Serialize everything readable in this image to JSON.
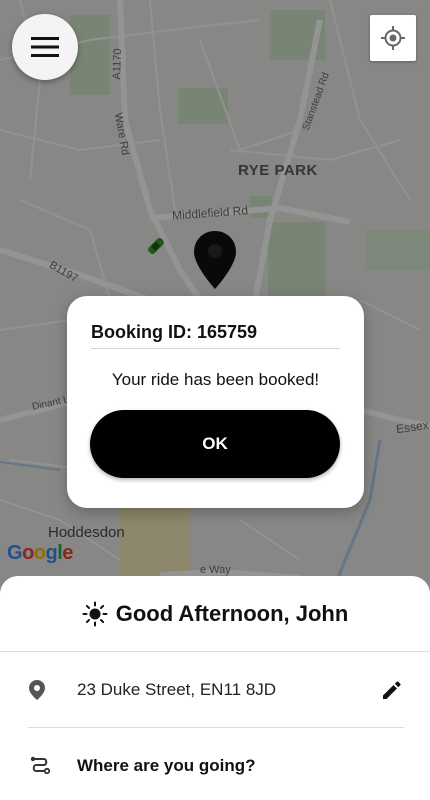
{
  "map": {
    "labels": {
      "rye_park": "RYE PARK",
      "middlefield_rd": "Middlefield Rd",
      "a1170": "A1170",
      "ware_rd": "Ware Rd",
      "stanstead_rd": "Stanstead Rd",
      "b1197": "B1197",
      "dinant": "Dinant L",
      "essex": "Essex",
      "hoddesdon": "Hoddesdon",
      "way": "e Way"
    },
    "attribution": [
      "G",
      "o",
      "o",
      "g",
      "l",
      "e"
    ]
  },
  "colors": {
    "google": [
      "#4285F4",
      "#EA4335",
      "#FBBC05",
      "#4285F4",
      "#34A853",
      "#EA4335"
    ],
    "accent": "#000000"
  },
  "top_controls": {
    "menu_icon": "hamburger-icon",
    "locate_icon": "crosshair-icon"
  },
  "dialog": {
    "title": "Booking ID: 165759",
    "message": "Your ride has been booked!",
    "ok_label": "OK"
  },
  "panel": {
    "greeting_icon": "sun-icon",
    "greeting": "Good Afternoon, John",
    "address_icon": "location-pin-icon",
    "address": "23 Duke Street, EN11 8JD",
    "edit_icon": "pencil-icon",
    "destination_icon": "route-icon",
    "destination_placeholder": "Where are you going?"
  }
}
